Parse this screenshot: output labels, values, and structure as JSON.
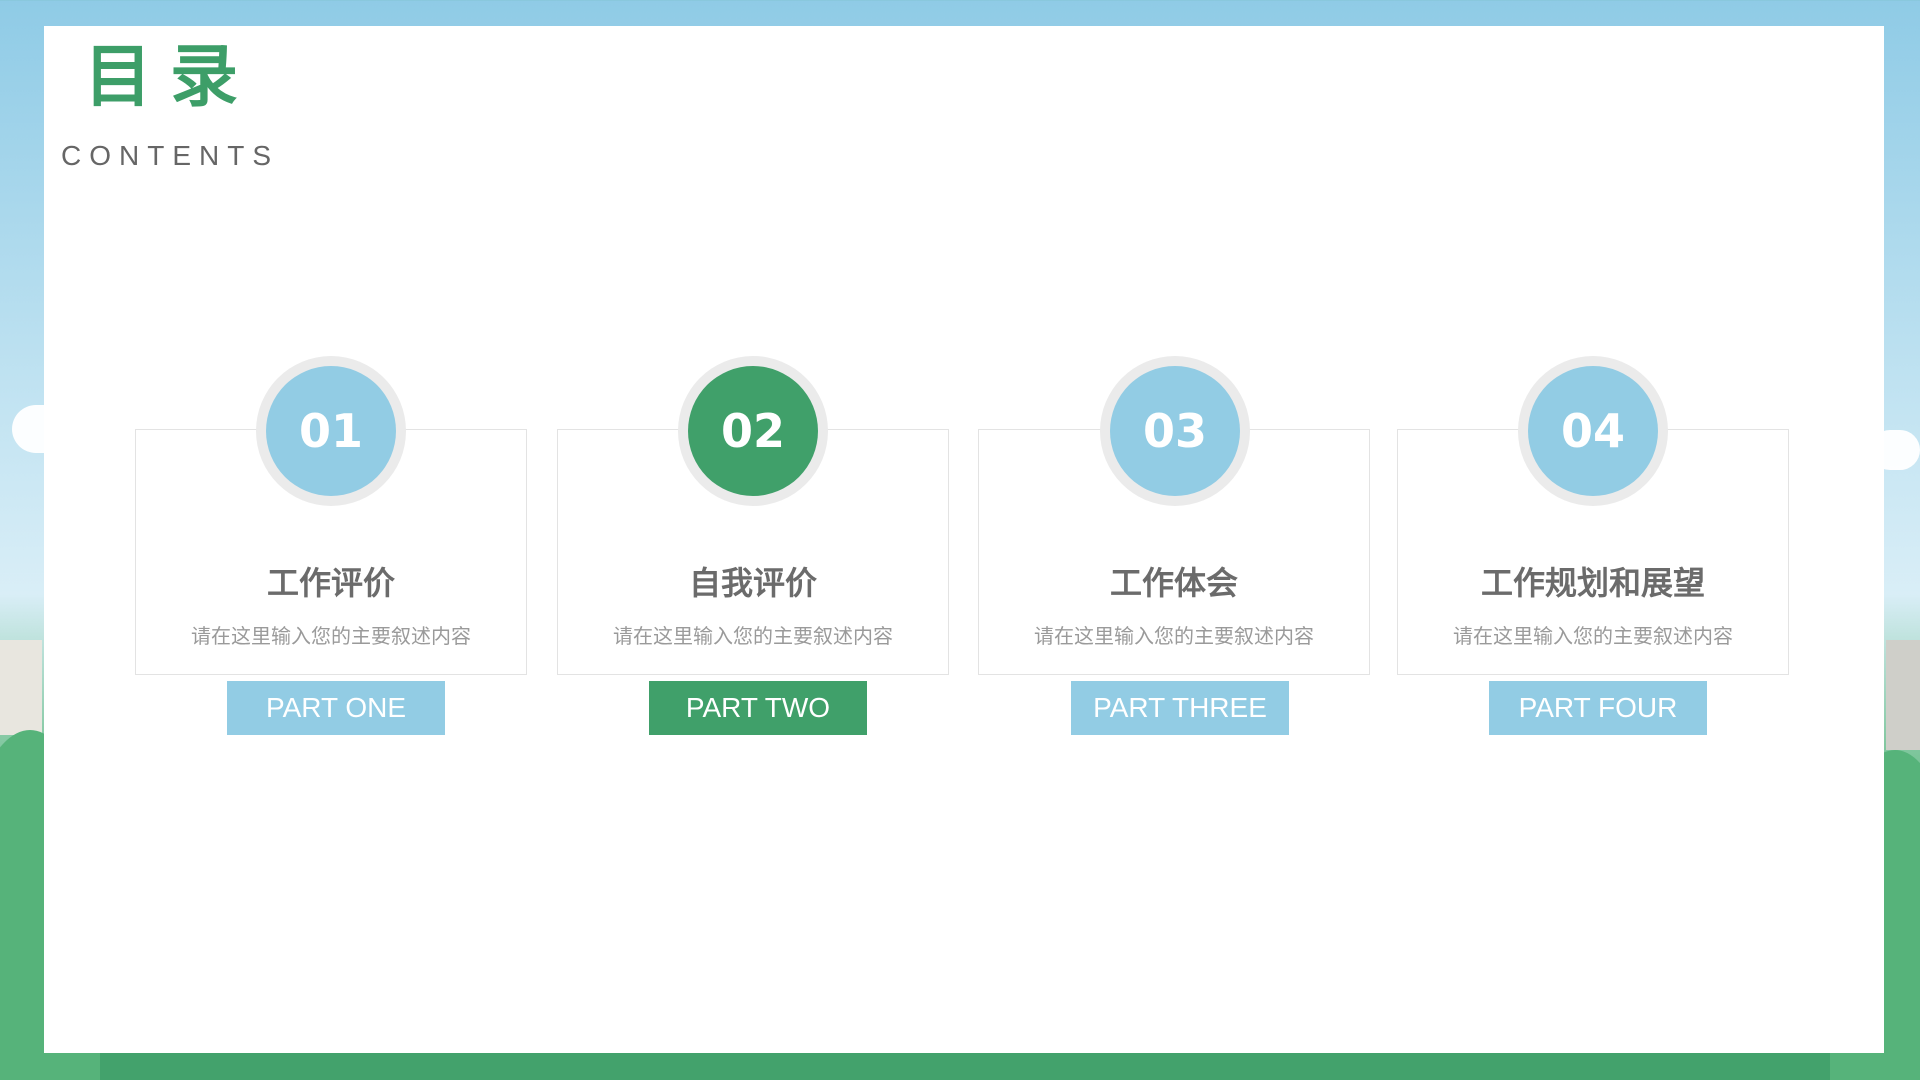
{
  "header": {
    "title_cn": "目录",
    "title_en": "CONTENTS"
  },
  "colors": {
    "green": "#40a06a",
    "blue": "#92cce4"
  },
  "items": [
    {
      "number": "01",
      "title": "工作评价",
      "description": "请在这里输入您的主要叙述内容",
      "part": "PART ONE",
      "accent": "blue"
    },
    {
      "number": "02",
      "title": "自我评价",
      "description": "请在这里输入您的主要叙述内容",
      "part": "PART TWO",
      "accent": "green"
    },
    {
      "number": "03",
      "title": "工作体会",
      "description": "请在这里输入您的主要叙述内容",
      "part": "PART THREE",
      "accent": "blue"
    },
    {
      "number": "04",
      "title": "工作规划和展望",
      "description": "请在这里输入您的主要叙述内容",
      "part": "PART FOUR",
      "accent": "blue"
    }
  ]
}
